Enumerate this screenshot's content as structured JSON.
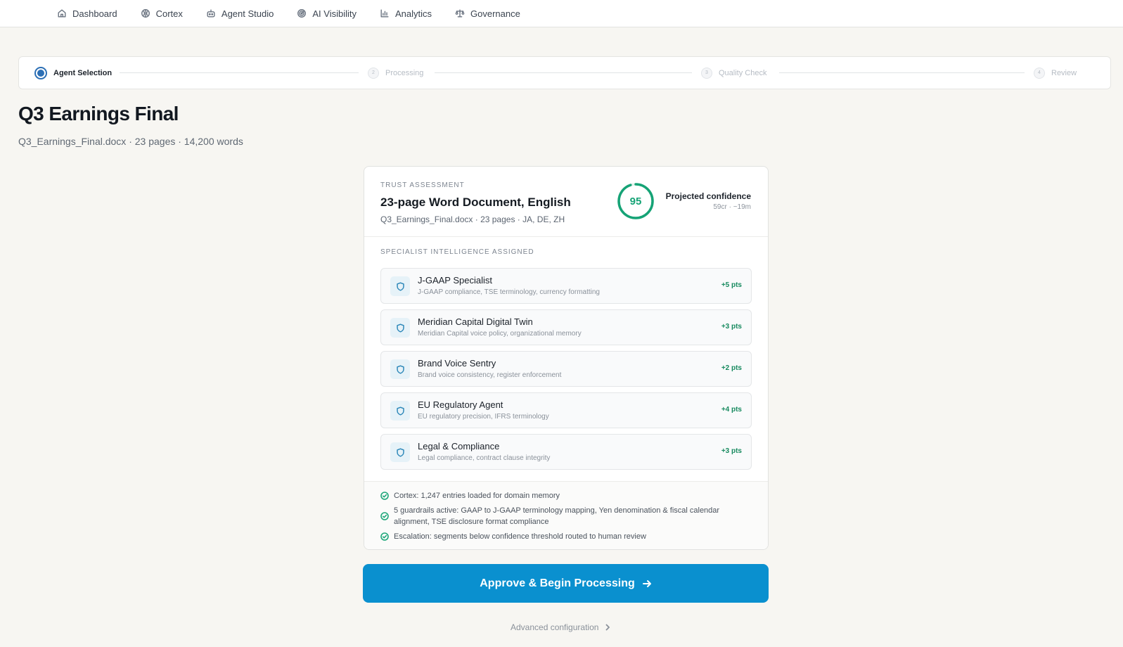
{
  "nav": {
    "items": [
      {
        "label": "Dashboard",
        "icon": "home-icon"
      },
      {
        "label": "Cortex",
        "icon": "brain-icon"
      },
      {
        "label": "Agent Studio",
        "icon": "bot-icon"
      },
      {
        "label": "AI Visibility",
        "icon": "radar-icon"
      },
      {
        "label": "Analytics",
        "icon": "bar-chart-icon"
      },
      {
        "label": "Governance",
        "icon": "scales-icon"
      }
    ]
  },
  "stepper": {
    "steps": [
      {
        "number": "1",
        "label": "Agent Selection",
        "state": "active"
      },
      {
        "number": "2",
        "label": "Processing",
        "state": "upcoming"
      },
      {
        "number": "3",
        "label": "Quality Check",
        "state": "upcoming"
      },
      {
        "number": "4",
        "label": "Review",
        "state": "upcoming"
      }
    ]
  },
  "page": {
    "title": "Q3 Earnings Final",
    "subtitle": "Q3_Earnings_Final.docx · 23 pages · 14,200 words"
  },
  "assessment": {
    "eyebrow": "TRUST ASSESSMENT",
    "title": "23-page Word Document, English",
    "subtitle": "Q3_Earnings_Final.docx · 23 pages · JA, DE, ZH",
    "score": "95",
    "score_fraction": 0.95,
    "confidence_label": "Projected confidence",
    "confidence_meta": "59cr · ~19m",
    "score_color": "#16a376"
  },
  "specialists": {
    "eyebrow": "SPECIALIST INTELLIGENCE ASSIGNED",
    "items": [
      {
        "name": "J-GAAP Specialist",
        "desc": "J-GAAP compliance, TSE terminology, currency formatting",
        "pts": "+5 pts"
      },
      {
        "name": "Meridian Capital Digital Twin",
        "desc": "Meridian Capital voice policy, organizational memory",
        "pts": "+3 pts"
      },
      {
        "name": "Brand Voice Sentry",
        "desc": "Brand voice consistency, register enforcement",
        "pts": "+2 pts"
      },
      {
        "name": "EU Regulatory Agent",
        "desc": "EU regulatory precision, IFRS terminology",
        "pts": "+4 pts"
      },
      {
        "name": "Legal & Compliance",
        "desc": "Legal compliance, contract clause integrity",
        "pts": "+3 pts"
      }
    ]
  },
  "checks": [
    "Cortex: 1,247 entries loaded for domain memory",
    "5 guardrails active: GAAP to J-GAAP terminology mapping, Yen denomination & fiscal calendar alignment, TSE disclosure format compliance",
    "Escalation: segments below confidence threshold routed to human review"
  ],
  "actions": {
    "approve_label": "Approve & Begin Processing",
    "advanced_label": "Advanced configuration",
    "primary_color": "#0a90cf"
  }
}
